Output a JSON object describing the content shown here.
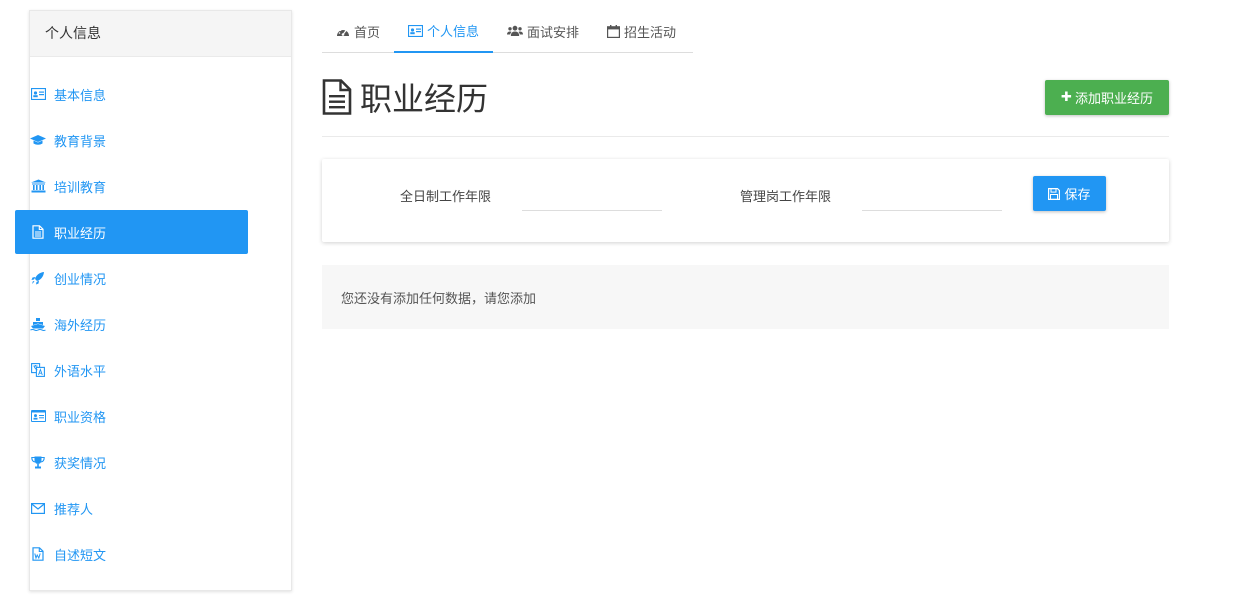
{
  "sidebar": {
    "title": "个人信息",
    "items": [
      {
        "label": "基本信息",
        "icon": "id-card-icon"
      },
      {
        "label": "教育背景",
        "icon": "graduation-cap-icon"
      },
      {
        "label": "培训教育",
        "icon": "institution-icon"
      },
      {
        "label": "职业经历",
        "icon": "file-text-icon",
        "active": true
      },
      {
        "label": "创业情况",
        "icon": "rocket-icon"
      },
      {
        "label": "海外经历",
        "icon": "ship-icon"
      },
      {
        "label": "外语水平",
        "icon": "language-icon"
      },
      {
        "label": "职业资格",
        "icon": "certificate-card-icon"
      },
      {
        "label": "获奖情况",
        "icon": "trophy-icon"
      },
      {
        "label": "推荐人",
        "icon": "envelope-icon"
      },
      {
        "label": "自述短文",
        "icon": "word-file-icon"
      }
    ]
  },
  "tabs": [
    {
      "label": "首页",
      "icon": "dashboard-icon"
    },
    {
      "label": "个人信息",
      "icon": "id-card-icon",
      "active": true
    },
    {
      "label": "面试安排",
      "icon": "users-icon"
    },
    {
      "label": "招生活动",
      "icon": "calendar-icon"
    }
  ],
  "page": {
    "title": "职业经历",
    "add_button": "添加职业经历"
  },
  "form": {
    "fulltime_label": "全日制工作年限",
    "fulltime_value": "",
    "management_label": "管理岗工作年限",
    "management_value": "",
    "save_label": "保存"
  },
  "empty_message": "您还没有添加任何数据，请您添加",
  "colors": {
    "primary": "#2196f3",
    "success": "#4caf50"
  }
}
